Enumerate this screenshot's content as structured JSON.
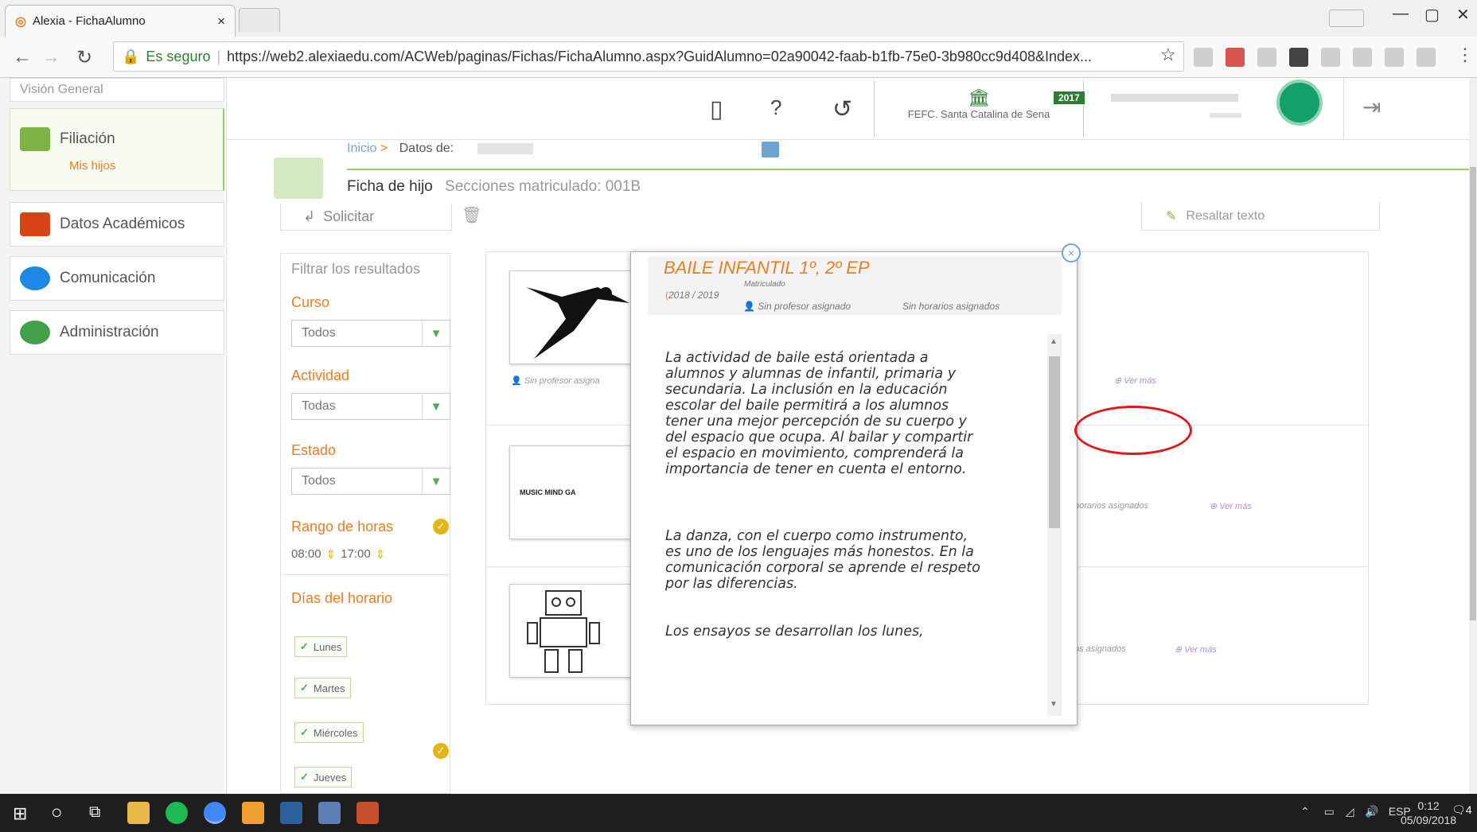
{
  "browser": {
    "tab_title": "Alexia - FichaAlumno",
    "tab_close": "×",
    "secure_label": "Es seguro",
    "url": "https://web2.alexiaedu.com/ACWeb/paginas/Fichas/FichaAlumno.aspx?GuidAlumno=02a90042-faab-b1fb-75e0-3b980cc9d408&Index...",
    "window_controls": [
      "—",
      "▢",
      "✕"
    ]
  },
  "sidebar": {
    "top_partial": "Visión General",
    "items": [
      {
        "label": "Filiación",
        "sublabel": "Mis hijos",
        "icon": "filiacion-icon"
      },
      {
        "label": "Datos Académicos",
        "icon": "graduation-cap-icon"
      },
      {
        "label": "Comunicación",
        "icon": "chat-bubbles-icon"
      },
      {
        "label": "Administración",
        "icon": "gears-icon"
      }
    ]
  },
  "header": {
    "school_name": "FEFC. Santa Catalina de Sena",
    "year_badge": "2017",
    "icons": [
      "tablet-icon",
      "help-icon",
      "history-icon",
      "logout-icon"
    ]
  },
  "breadcrumb": {
    "inicio": "Inicio",
    "separator": ">",
    "datos": "Datos de:"
  },
  "page": {
    "title": "Ficha de hijo",
    "sections": "Secciones matriculado: 001B"
  },
  "toolbar": {
    "solicitar": "Solicitar",
    "resaltar": "Resaltar texto"
  },
  "filter": {
    "title": "Filtrar los resultados",
    "curso_label": "Curso",
    "curso_value": "Todos",
    "actividad_label": "Actividad",
    "actividad_value": "Todas",
    "estado_label": "Estado",
    "estado_value": "Todos",
    "rango_label": "Rango de horas",
    "hora_inicio": "08:00",
    "hora_fin": "17:00",
    "dias_label": "Días del horario",
    "dias": [
      "Lunes",
      "Martes",
      "Miércoles",
      "Jueves"
    ]
  },
  "activities": {
    "row1_prof": "Sin profesor asigna",
    "row1_vermas": "Ver más",
    "row2_logo": "MUSIC MIND GA",
    "row2_horarios": "horarios asignados",
    "row2_vermas": "Ver más",
    "row3_horarios": "os asignados",
    "row3_vermas": "Ver más"
  },
  "modal": {
    "title": "BAILE INFANTIL 1º, 2º EP",
    "status": "Matriculado",
    "year": "2018 / 2019",
    "profesor": "Sin profesor asignado",
    "horarios": "Sin horarios asignados",
    "close": "×",
    "paragraph1": " La actividad de baile está orientada a alumnos y alumnas de infantil, primaria y secundaria. La inclusión en la educación  escolar del baile permitirá a los alumnos tener una mejor percepción de su cuerpo y del espacio que ocupa. Al bailar y compartir el espacio en movimiento, comprenderá la importancia de tener en cuenta el entorno.",
    "paragraph2": "La danza, con el cuerpo como instrumento, es uno de los lenguajes más honestos.  En la comunicación corporal se aprende el respeto por las diferencias.",
    "paragraph3": "Los ensayos se desarrollan los lunes,"
  },
  "taskbar": {
    "lang": "ESP",
    "time": "0:12",
    "date": "05/09/2018",
    "notifications": "4"
  },
  "colors": {
    "accent_orange": "#e67e22",
    "accent_green": "#4caf50",
    "highlight_red": "#e0191b"
  }
}
